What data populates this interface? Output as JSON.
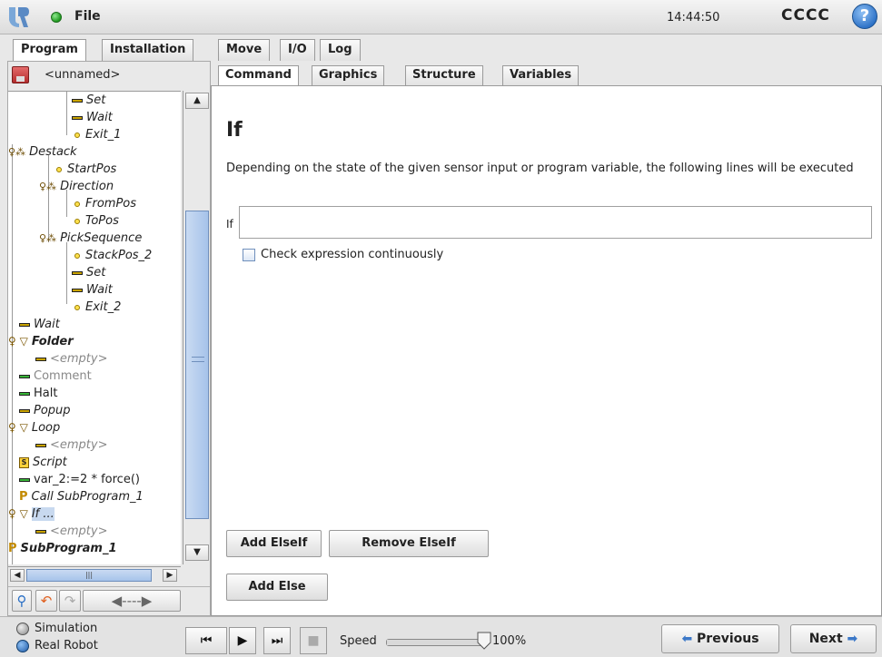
{
  "topbar": {
    "file_label": "File",
    "clock": "14:44:50",
    "robot_name": "CCCC",
    "help_glyph": "?"
  },
  "main_tabs": [
    {
      "label": "Program"
    },
    {
      "label": "Installation"
    },
    {
      "label": "Move"
    },
    {
      "label": "I/O"
    },
    {
      "label": "Log"
    }
  ],
  "program": {
    "name": "<unnamed>"
  },
  "tree": [
    {
      "label": "Set",
      "icon": "set-bar-icon",
      "style": "italic"
    },
    {
      "label": "Wait",
      "icon": "wait-bar-icon",
      "style": "italic"
    },
    {
      "label": "Exit_1",
      "icon": "waypoint-dot-icon",
      "style": "italic"
    },
    {
      "label": "Destack",
      "icon": "destack-node-icon",
      "style": "italic"
    },
    {
      "label": "StartPos",
      "icon": "waypoint-dot-icon",
      "style": "italic"
    },
    {
      "label": "Direction",
      "icon": "direction-node-icon",
      "style": "italic"
    },
    {
      "label": "FromPos",
      "icon": "waypoint-dot-icon",
      "style": "italic"
    },
    {
      "label": "ToPos",
      "icon": "waypoint-dot-icon",
      "style": "italic"
    },
    {
      "label": "PickSequence",
      "icon": "sequence-node-icon",
      "style": "italic"
    },
    {
      "label": "StackPos_2",
      "icon": "waypoint-dot-icon",
      "style": "italic"
    },
    {
      "label": "Set",
      "icon": "set-bar-icon",
      "style": "italic"
    },
    {
      "label": "Wait",
      "icon": "wait-bar-icon",
      "style": "italic"
    },
    {
      "label": "Exit_2",
      "icon": "waypoint-dot-icon",
      "style": "italic"
    },
    {
      "label": "Wait",
      "icon": "wait-bar-icon",
      "style": "italic"
    },
    {
      "label": "Folder",
      "icon": "folder-triangle-icon",
      "style": "bold-italic"
    },
    {
      "label": "<empty>",
      "icon": "empty-bar-icon",
      "style": "grey-italic"
    },
    {
      "label": "Comment",
      "icon": "comment-bar-icon",
      "style": "grey"
    },
    {
      "label": "Halt",
      "icon": "halt-bar-icon",
      "style": "normal"
    },
    {
      "label": "Popup",
      "icon": "popup-bar-icon",
      "style": "italic"
    },
    {
      "label": "Loop",
      "icon": "loop-triangle-icon",
      "style": "italic"
    },
    {
      "label": "<empty>",
      "icon": "empty-bar-icon",
      "style": "grey-italic"
    },
    {
      "label": "Script",
      "icon": "script-icon",
      "style": "italic"
    },
    {
      "label": "var_2:=2 * force()",
      "icon": "assignment-bar-icon",
      "style": "normal"
    },
    {
      "label": "Call SubProgram_1",
      "icon": "call-p-icon",
      "style": "italic"
    },
    {
      "label": "If ...",
      "icon": "if-triangle-icon",
      "style": "italic-selected"
    },
    {
      "label": "<empty>",
      "icon": "empty-bar-icon",
      "style": "grey-italic"
    },
    {
      "label": "SubProgram_1",
      "icon": "subprogram-p-icon",
      "style": "bold-italic"
    }
  ],
  "tree_scroll": {
    "hs_grip": "|||"
  },
  "tree_toolbar": {
    "search": "search-icon",
    "undo": "undo-icon",
    "redo": "redo-icon",
    "move": "move-arrows-icon"
  },
  "sub_tabs": [
    {
      "label": "Command"
    },
    {
      "label": "Graphics"
    },
    {
      "label": "Structure"
    },
    {
      "label": "Variables"
    }
  ],
  "command": {
    "title": "If",
    "description": "Depending on the state of the given sensor input or program variable, the following lines will be executed",
    "if_label": "If",
    "if_value": "",
    "check_label": "Check expression continuously",
    "add_elseif": "Add ElseIf",
    "remove_elseif": "Remove ElseIf",
    "add_else": "Add Else"
  },
  "footer": {
    "simulation_label": "Simulation",
    "real_robot_label": "Real Robot",
    "speed_label": "Speed",
    "speed_value": "100%",
    "speed_fraction": 1.0,
    "previous_label": "Previous",
    "next_label": "Next"
  },
  "colors": {
    "accent_blue": "#3c78c8",
    "status_green": "#1f9a1f",
    "selection": "#c8d9ef"
  }
}
